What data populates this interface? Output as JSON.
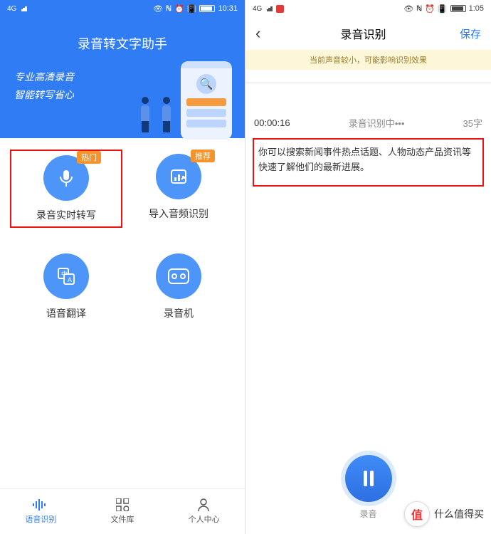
{
  "left": {
    "status_time": "10:31",
    "banner_title": "录音转文字助手",
    "banner_line1": "专业高清录音",
    "banner_line2": "智能转写省心",
    "tiles": [
      {
        "label": "录音实时转写",
        "badge": "热门"
      },
      {
        "label": "导入音频识别",
        "badge": "推荐"
      },
      {
        "label": "语音翻译",
        "badge": ""
      },
      {
        "label": "录音机",
        "badge": ""
      }
    ],
    "nav": [
      {
        "label": "语音识别"
      },
      {
        "label": "文件库"
      },
      {
        "label": "个人中心"
      }
    ]
  },
  "right": {
    "status_time": "1:05",
    "title": "录音识别",
    "save": "保存",
    "warning": "当前声音较小，可能影响识别效果",
    "elapsed": "00:00:16",
    "recognizing": "录音识别中•••",
    "char_count": "35字",
    "transcript": "你可以搜索新闻事件热点话题、人物动态产品资讯等快速了解他们的最新进展。",
    "record_label": "录音"
  },
  "watermark": {
    "icon_char": "值",
    "text": "什么值得买"
  }
}
